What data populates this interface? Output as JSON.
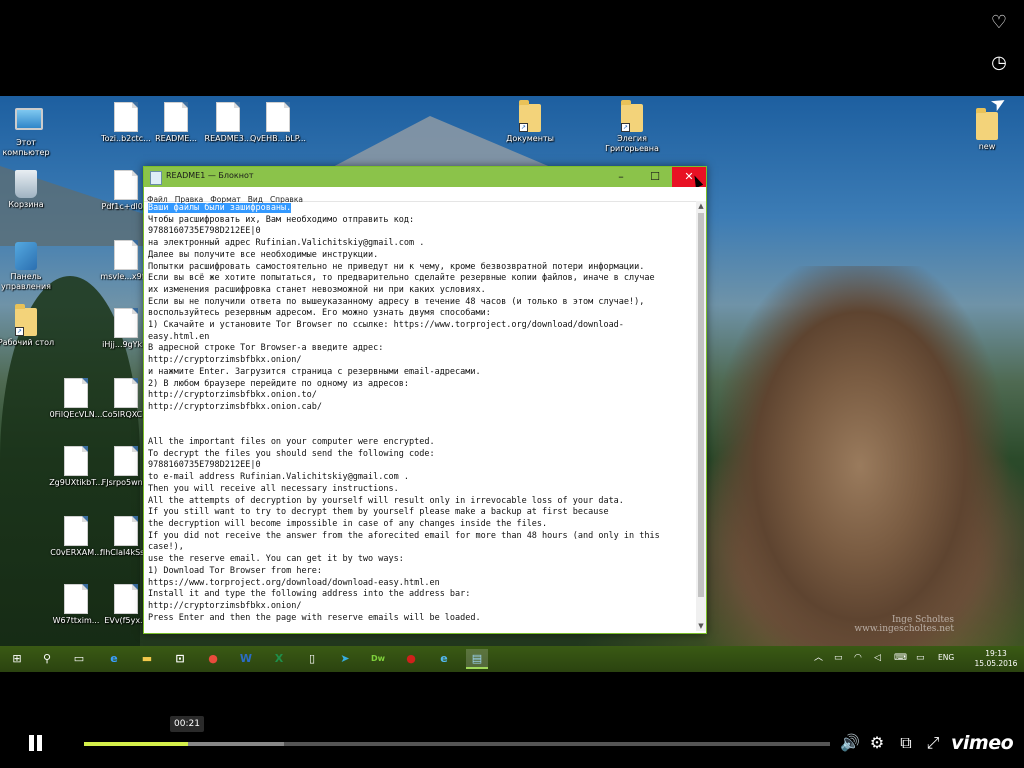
{
  "desktop": {
    "icons": [
      {
        "label": "Этот компьютер",
        "kind": "pc"
      },
      {
        "label": "Корзина",
        "kind": "bin"
      },
      {
        "label": "Панель управления",
        "kind": "cpanel"
      },
      {
        "label": "Рабочий стол",
        "kind": "folder"
      },
      {
        "label": "Tozi..b2ctc...",
        "kind": "doc"
      },
      {
        "label": "README...",
        "kind": "doc"
      },
      {
        "label": "README3...",
        "kind": "doc"
      },
      {
        "label": "QvEHB...bLP...",
        "kind": "doc"
      },
      {
        "label": "Pdf1c+dl0...",
        "kind": "doc"
      },
      {
        "label": "msvle...x9f...",
        "kind": "doc"
      },
      {
        "label": "iHjj...9gYk...",
        "kind": "doc"
      },
      {
        "label": "0FilQEcVLN...",
        "kind": "doc"
      },
      {
        "label": "Co5lRQXC...",
        "kind": "doc"
      },
      {
        "label": "Zg9UXtikbT...",
        "kind": "doc"
      },
      {
        "label": "FJsrpo5wn...",
        "kind": "doc"
      },
      {
        "label": "C0vERXAM...",
        "kind": "doc"
      },
      {
        "label": "fIhClaI4kSs...",
        "kind": "doc"
      },
      {
        "label": "W67ttxim...",
        "kind": "doc"
      },
      {
        "label": "EVv(f5yx...",
        "kind": "doc"
      },
      {
        "label": "Документы",
        "kind": "folder"
      },
      {
        "label": "Элегия Григорьевна",
        "kind": "folder"
      },
      {
        "label": "new",
        "kind": "folder"
      }
    ],
    "watermark_line1": "Inge Scholtes",
    "watermark_line2": "www.ingescholtes.net"
  },
  "notepad": {
    "title": "README1 — Блокнот",
    "menu": [
      "Файл",
      "Правка",
      "Формат",
      "Вид",
      "Справка"
    ],
    "minimize": "–",
    "maximize": "☐",
    "close": "✕",
    "highlight": "Ваши файлы были зашифрованы.",
    "lines": [
      "Чтобы расшифровать их, Вам необходимо отправить код:",
      "9788160735E798D212EE|0",
      "на электронный адрес Rufinian.Valichitskiy@gmail.com .",
      "Далее вы получите все необходимые инструкции.",
      "Попытки расшифровать самостоятельно не приведут ни к чему, кроме безвозвратной потери информации.",
      "Если вы всё же хотите попытаться, то предварительно сделайте резервные копии файлов, иначе в случае",
      "их изменения расшифровка станет невозможной ни при каких условиях.",
      "Если вы не получили ответа по вышеуказанному адресу в течение 48 часов (и только в этом случае!),",
      "воспользуйтесь резервным адресом. Его можно узнать двумя способами:",
      "1) Скачайте и установите Tor Browser по ссылке: https://www.torproject.org/download/download-",
      "easy.html.en",
      "В адресной строке Tor Browser-а введите адрес:",
      "http://cryptorzimsbfbkx.onion/",
      "и нажмите Enter. Загрузится страница с резервными email-адресами.",
      "2) В любом браузере перейдите по одному из адресов:",
      "http://cryptorzimsbfbkx.onion.to/",
      "http://cryptorzimsbfbkx.onion.cab/",
      "",
      "",
      "All the important files on your computer were encrypted.",
      "To decrypt the files you should send the following code:",
      "9788160735E798D212EE|0",
      "to e-mail address Rufinian.Valichitskiy@gmail.com .",
      "Then you will receive all necessary instructions.",
      "All the attempts of decryption by yourself will result only in irrevocable loss of your data.",
      "If you still want to try to decrypt them by yourself please make a backup at first because",
      "the decryption will become impossible in case of any changes inside the files.",
      "If you did not receive the answer from the aforecited email for more than 48 hours (and only in this",
      "case!),",
      "use the reserve email. You can get it by two ways:",
      "1) Download Tor Browser from here:",
      "https://www.torproject.org/download/download-easy.html.en",
      "Install it and type the following address into the address bar:",
      "http://cryptorzimsbfbkx.onion/",
      "Press Enter and then the page with reserve emails will be loaded."
    ]
  },
  "taskbar": {
    "start_glyph": "⊞",
    "search_glyph": "⚲",
    "taskview_glyph": "▭",
    "apps": [
      {
        "name": "edge",
        "glyph": "e",
        "color": "#3aa0ff"
      },
      {
        "name": "explorer",
        "glyph": "▬",
        "color": "#f2c94c"
      },
      {
        "name": "store",
        "glyph": "⊡",
        "color": "#ffffff"
      },
      {
        "name": "chrome",
        "glyph": "●",
        "color": "#e94b3c"
      },
      {
        "name": "word",
        "glyph": "W",
        "color": "#2b6cc4"
      },
      {
        "name": "excel",
        "glyph": "X",
        "color": "#1f8f4a"
      },
      {
        "name": "file",
        "glyph": "▯",
        "color": "#ffffff"
      },
      {
        "name": "telegram",
        "glyph": "➤",
        "color": "#37aee2"
      },
      {
        "name": "dreamweaver",
        "glyph": "Dw",
        "color": "#7fd13b"
      },
      {
        "name": "record",
        "glyph": "●",
        "color": "#d0201b"
      },
      {
        "name": "ie",
        "glyph": "e",
        "color": "#53b9f0"
      },
      {
        "name": "notepad",
        "glyph": "▤",
        "color": "#9ed5f5"
      }
    ],
    "tray": {
      "up": "︿",
      "battery": "▭",
      "network": "◠",
      "volume": "◁",
      "keyboard": "⌨",
      "msg": "▭",
      "lang": "ENG"
    },
    "time": "19:13",
    "date": "15.05.2016"
  },
  "player": {
    "timecode": "00:21",
    "progress_fraction": 0.139,
    "buffered_fraction": 0.268,
    "brand": "vimeo",
    "icons": {
      "like": "♡",
      "watch_later": "◷",
      "share": "➤",
      "pause": "pause",
      "volume": "🔊",
      "settings": "⚙",
      "pip": "⧉",
      "fullscreen": "⤢"
    }
  }
}
